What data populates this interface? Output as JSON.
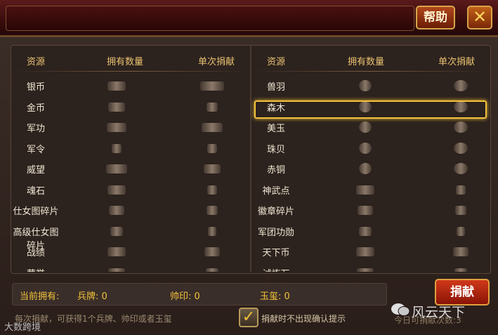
{
  "header": {
    "help_label": "帮助",
    "close_label": "✕"
  },
  "table_left": {
    "headers": [
      "资源",
      "拥有数量",
      "单次捐献"
    ],
    "rows": [
      "银币",
      "金币",
      "军功",
      "军令",
      "威望",
      "魂石",
      "仕女图碎片",
      "高级仕女图碎片",
      "战绩",
      "荣誉"
    ]
  },
  "table_right": {
    "headers": [
      "资源",
      "拥有数量",
      "单次捐献"
    ],
    "rows": [
      "兽羽",
      "森木",
      "美玉",
      "珠贝",
      "赤铜",
      "神武点",
      "徽章碎片",
      "军团功勋",
      "天下币",
      "试炼石"
    ],
    "selected_row": "森木"
  },
  "bottom": {
    "current_label": "当前拥有:",
    "bingpai": "兵牌: 0",
    "shuaiyin": "帅印: 0",
    "yuxi": "玉玺: 0",
    "donate_label": "捐献",
    "hint": "每次捐献，可获得1个兵牌、帅印或者玉玺",
    "checkbox_checked": true,
    "checkbox_label": "捐献时不出现确认提示",
    "donate_count_label": "今日可捐献次数:3"
  },
  "watermarks": {
    "wechat": "风云天下",
    "corner": "大数跨境"
  }
}
